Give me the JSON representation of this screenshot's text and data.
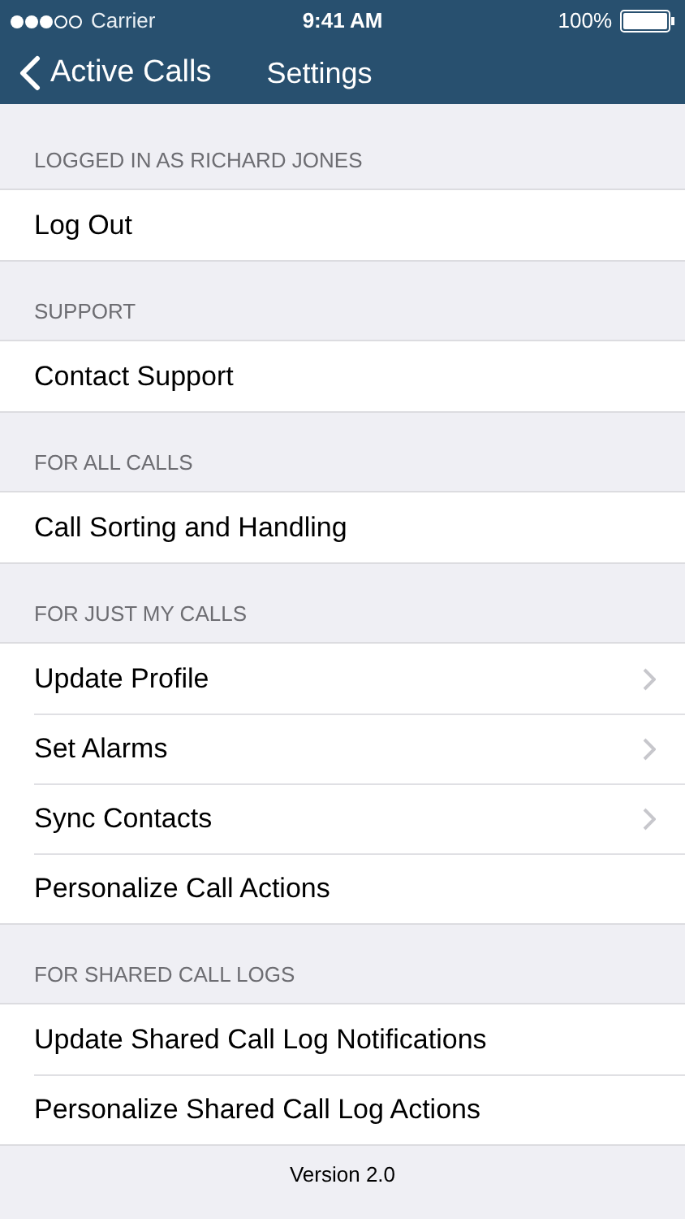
{
  "status_bar": {
    "carrier": "Carrier",
    "time": "9:41 AM",
    "battery": "100%"
  },
  "nav": {
    "back": "Active Calls",
    "title": "Settings"
  },
  "sections": [
    {
      "header": "LOGGED IN AS RICHARD JONES",
      "rows": [
        {
          "label": "Log Out",
          "chevron": false
        }
      ]
    },
    {
      "header": "SUPPORT",
      "rows": [
        {
          "label": "Contact Support",
          "chevron": false
        }
      ]
    },
    {
      "header": "FOR ALL CALLS",
      "rows": [
        {
          "label": "Call Sorting and Handling",
          "chevron": false
        }
      ]
    },
    {
      "header": "FOR JUST MY CALLS",
      "rows": [
        {
          "label": "Update Profile",
          "chevron": true
        },
        {
          "label": "Set Alarms",
          "chevron": true
        },
        {
          "label": "Sync Contacts",
          "chevron": true
        },
        {
          "label": "Personalize Call Actions",
          "chevron": false
        }
      ]
    },
    {
      "header": "FOR SHARED CALL LOGS",
      "rows": [
        {
          "label": "Update Shared Call Log Notifications",
          "chevron": false
        },
        {
          "label": "Personalize Shared Call Log Actions",
          "chevron": false
        }
      ]
    }
  ],
  "footer": "Version 2.0"
}
